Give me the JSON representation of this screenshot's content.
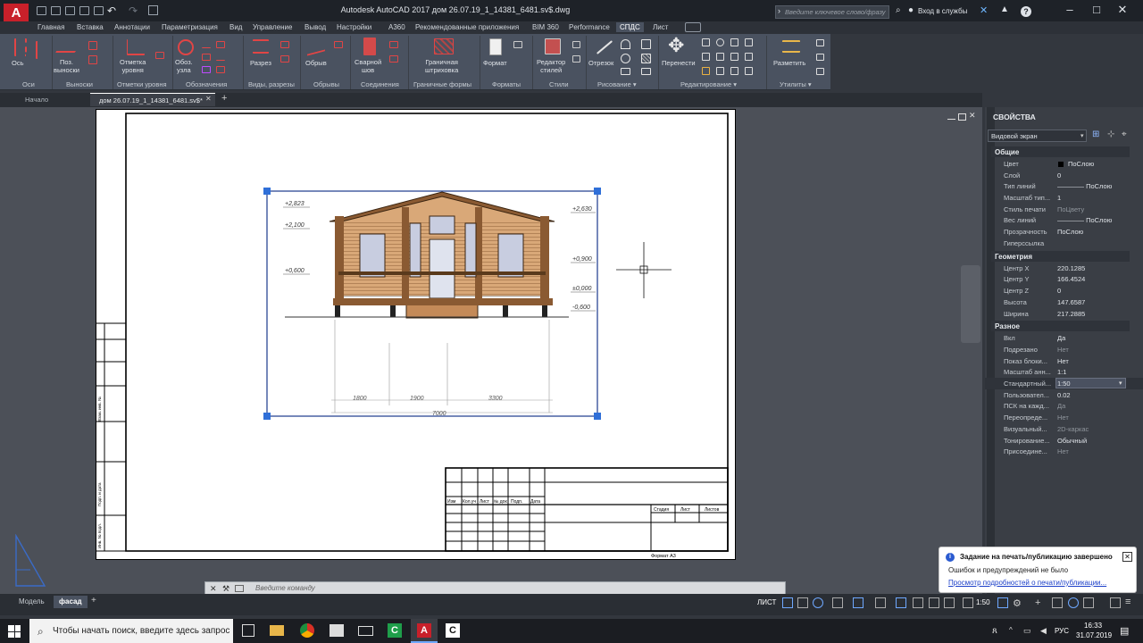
{
  "app": {
    "logo": "A",
    "title": "Autodesk AutoCAD 2017     дом 26.07.19_1_14381_6481.sv$.dwg",
    "search_placeholder": "Введите ключевое слово/фразу",
    "login": "Вход в службы"
  },
  "ribbon_tabs": [
    "Главная",
    "Вставка",
    "Аннотации",
    "Параметризация",
    "Вид",
    "Управление",
    "Вывод",
    "Настройки",
    "A360",
    "Рекомендованные приложения",
    "BIM 360",
    "Performance",
    "СПДС",
    "Лист"
  ],
  "active_ribbon_tab": "СПДС",
  "ribbon": {
    "buttons": [
      "Ось",
      "Поз.\nвыноски",
      "Отметка\nуровня",
      "Обоз.\nузла",
      "Разрез",
      "Обрыв",
      "Сварной\nшов",
      "Граничная\nштриховка",
      "Формат",
      "Редактор\nстилей",
      "Отрезок",
      "Перенести",
      "Разметить"
    ],
    "panels": [
      "Оси",
      "Выноски",
      "Отметки уровня",
      "Обозначения",
      "Виды, разрезы",
      "Обрывы",
      "Соединения",
      "Граничные формы",
      "Форматы",
      "Стили",
      "Рисование ▾",
      "Редактирование ▾",
      "Утилиты ▾"
    ]
  },
  "doc_tabs": {
    "start": "Начало",
    "active": "дом 26.07.19_1_14381_6481.sv$*",
    "add": "+"
  },
  "drawing": {
    "levels_left": [
      "+2,823",
      "+2,100",
      "+0,600"
    ],
    "levels_right": [
      "+2,630",
      "+0,900",
      "±0,000",
      "-0,600"
    ],
    "dims": [
      "1800",
      "1900",
      "3300",
      "7000"
    ],
    "title_block_headers": [
      "Изм",
      "Кол.уч",
      "Лист",
      "№ док",
      "Подп.",
      "Дата"
    ],
    "title_block_small": [
      "Стадия",
      "Лист",
      "Листов"
    ],
    "format_label": "Формат А3",
    "side_stamps": [
      "Взам. инв. №",
      "Подп. и дата",
      "Инв. № подл."
    ]
  },
  "properties": {
    "title": "СВОЙСТВА",
    "selector": "Видовой экран",
    "sections": [
      {
        "name": "Общие",
        "rows": [
          [
            "Цвет",
            "ПоСлою"
          ],
          [
            "Слой",
            "0"
          ],
          [
            "Тип линий",
            "———— ПоСлою"
          ],
          [
            "Масштаб тип...",
            "1"
          ],
          [
            "Стиль печати",
            "ПоЦвету"
          ],
          [
            "Вес линий",
            "———— ПоСлою"
          ],
          [
            "Прозрачность",
            "ПоСлою"
          ],
          [
            "Гиперссылка",
            ""
          ]
        ]
      },
      {
        "name": "Геометрия",
        "rows": [
          [
            "Центр X",
            "220.1285"
          ],
          [
            "Центр Y",
            "166.4524"
          ],
          [
            "Центр Z",
            "0"
          ],
          [
            "Высота",
            "147.6587"
          ],
          [
            "Ширина",
            "217.2885"
          ]
        ]
      },
      {
        "name": "Разное",
        "rows": [
          [
            "Вкл",
            "Да"
          ],
          [
            "Подрезано",
            "Нет"
          ],
          [
            "Показ блоки...",
            "Нет"
          ],
          [
            "Масштаб анн...",
            "1:1"
          ],
          [
            "Стандартный...",
            "1:50"
          ],
          [
            "Пользовател...",
            "0.02"
          ],
          [
            "ПСК на кажд...",
            "Да"
          ],
          [
            "Переопреде...",
            "Нет"
          ],
          [
            "Визуальный...",
            "2D-каркас"
          ],
          [
            "Тонирование...",
            "Обычный"
          ],
          [
            "Присоедине...",
            "Нет"
          ]
        ]
      }
    ]
  },
  "command": {
    "placeholder": "Введите команду"
  },
  "layout_tabs": {
    "model": "Модель",
    "active": "фасад",
    "add": "+"
  },
  "status": {
    "space": "ЛИСТ",
    "scale": "1:50"
  },
  "toast": {
    "title": "Задание на печать/публикацию завершено",
    "message": "Ошибок и предупреждений не было",
    "link": "Просмотр подробностей о печати/публикации..."
  },
  "taskbar": {
    "search": "Чтобы начать поиск, введите здесь запрос",
    "time": "16:33",
    "date": "31.07.2019",
    "lang": "РУС"
  }
}
